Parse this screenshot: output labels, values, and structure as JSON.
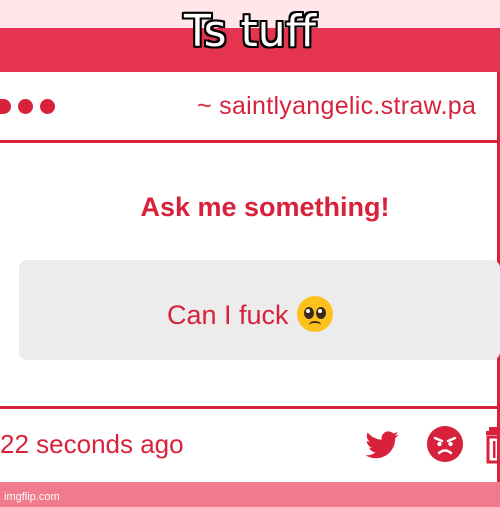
{
  "meme": {
    "caption": "Ts tuff",
    "watermark": "imgflip.com"
  },
  "header": {
    "url": "~ saintlyangelic.straw.pa"
  },
  "main": {
    "prompt": "Ask me something!",
    "question": "Can I fuck",
    "question_emoji": "pleading-face-icon"
  },
  "footer": {
    "timestamp": "22 seconds ago",
    "icons": [
      "twitter-icon",
      "angry-face-icon",
      "trash-icon"
    ]
  },
  "colors": {
    "accent": "#d8223c",
    "band": "#e5344f",
    "bottom_band": "#ef7b8c",
    "box": "#ececec"
  }
}
